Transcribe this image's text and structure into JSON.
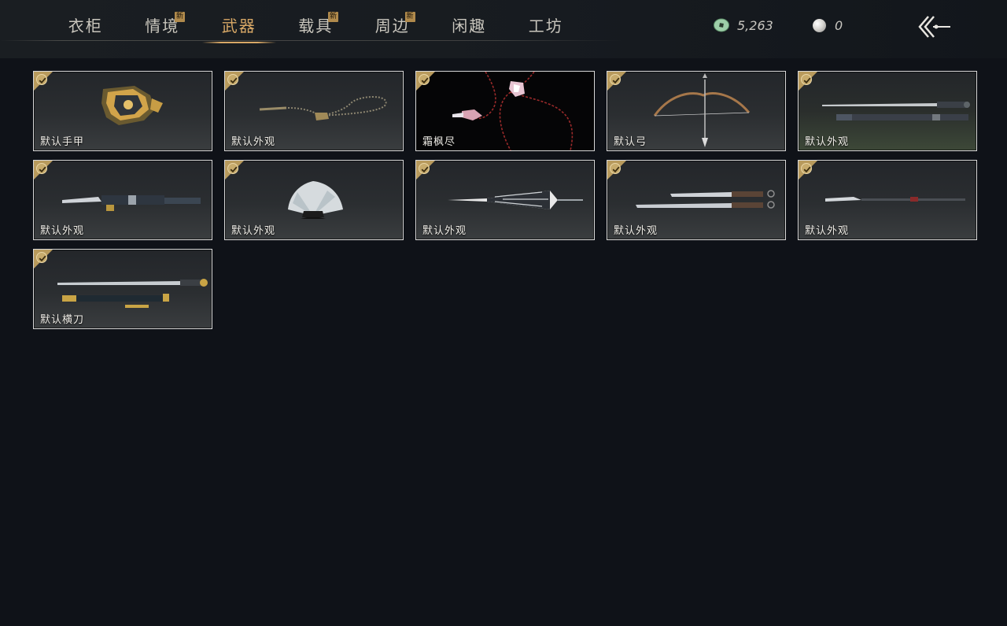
{
  "nav": {
    "tabs": [
      {
        "label": "衣柜",
        "is_new": false,
        "active": false
      },
      {
        "label": "情境",
        "is_new": true,
        "active": false
      },
      {
        "label": "武器",
        "is_new": false,
        "active": true
      },
      {
        "label": "载具",
        "is_new": true,
        "active": false
      },
      {
        "label": "周边",
        "is_new": true,
        "active": false
      },
      {
        "label": "闲趣",
        "is_new": false,
        "active": false
      },
      {
        "label": "工坊",
        "is_new": false,
        "active": false
      }
    ],
    "new_badge": "新"
  },
  "currency": {
    "jade": {
      "icon": "jade-coin-icon",
      "amount": "5,263"
    },
    "pearl": {
      "icon": "pearl-icon",
      "amount": "0"
    }
  },
  "back_icon": "back-arrow-icon",
  "items": [
    {
      "label": "默认手甲",
      "equipped": true,
      "art": "gauntlet"
    },
    {
      "label": "默认外观",
      "equipped": true,
      "art": "rope-dart"
    },
    {
      "label": "霜枫尽",
      "equipped": true,
      "art": "red-rope-dart"
    },
    {
      "label": "默认弓",
      "equipped": true,
      "art": "bow"
    },
    {
      "label": "默认外观",
      "equipped": true,
      "art": "twin-swords"
    },
    {
      "label": "默认外观",
      "equipped": true,
      "art": "sword"
    },
    {
      "label": "默认外观",
      "equipped": true,
      "art": "fan"
    },
    {
      "label": "默认外观",
      "equipped": true,
      "art": "umbrella"
    },
    {
      "label": "默认外观",
      "equipped": true,
      "art": "dual-dao"
    },
    {
      "label": "默认外观",
      "equipped": true,
      "art": "spear"
    },
    {
      "label": "默认横刀",
      "equipped": true,
      "art": "hengdao"
    }
  ],
  "colors": {
    "accent": "#d8a866",
    "background": "#0f1218",
    "check": "#c7ab6c",
    "card_border": "#d8d8d8"
  }
}
